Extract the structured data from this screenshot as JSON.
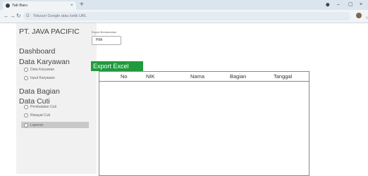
{
  "browser": {
    "tab_title": "Tab Baru",
    "tab_close": "×",
    "new_tab": "+",
    "address_placeholder": "Telusuri Google atau ketik URL",
    "window_controls": [
      "⬤",
      "–",
      "▢",
      "×"
    ],
    "star": "☆",
    "menu": "⋮"
  },
  "sidebar": {
    "brand": "PT. JAVA PACIFIC",
    "items": [
      {
        "label": "Dashboard"
      },
      {
        "label": "Data Karyawan",
        "children": [
          "Data Karyawan",
          "Input Karyawan"
        ]
      },
      {
        "label": "Data Bagian"
      },
      {
        "label": "Data Cuti",
        "children": [
          "Pembatalan Cuti",
          "Riwayat Cuti",
          "Laporan"
        ]
      }
    ]
  },
  "main": {
    "filter_label": "Export Berdasarkan",
    "filter_value": "Pilih",
    "export_button": "Export Excel",
    "table_headers": [
      "No",
      "NIK",
      "Nama",
      "Bagian",
      "Tanggal"
    ]
  },
  "colors": {
    "accent_green": "#1f9a3c",
    "sidebar_bg": "#f1f1f1"
  }
}
